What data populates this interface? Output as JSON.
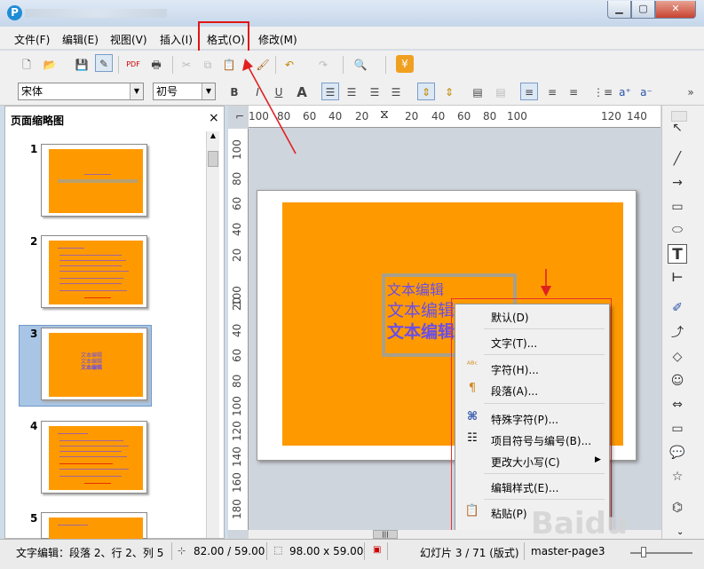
{
  "menubar": {
    "items": [
      "文件(F)",
      "编辑(E)",
      "视图(V)",
      "插入(I)",
      "格式(O)",
      "修改(M)"
    ]
  },
  "toolbar": {
    "font_name": "宋体",
    "font_size": "初号"
  },
  "panel": {
    "title": "页面缩略图",
    "close": "×",
    "slides": [
      {
        "num": "1"
      },
      {
        "num": "2"
      },
      {
        "num": "3",
        "lines": [
          "文本编辑",
          "文本编辑",
          "文本编辑"
        ]
      },
      {
        "num": "4"
      },
      {
        "num": "5"
      }
    ]
  },
  "ruler": {
    "h_ticks": [
      "100",
      "80",
      "60",
      "40",
      "20",
      "20",
      "40",
      "60",
      "80",
      "100",
      "120",
      "140"
    ],
    "v_ticks": [
      "100",
      "80",
      "60",
      "40",
      "20",
      "20",
      "40",
      "60",
      "80",
      "100",
      "120",
      "140",
      "160",
      "180"
    ]
  },
  "slide": {
    "text_lines": [
      "文本编辑",
      "文本编辑",
      "文本编辑"
    ]
  },
  "context_menu": {
    "items": [
      {
        "label": "默认(D)",
        "icon": ""
      },
      {
        "label": "文字(T)...",
        "icon": ""
      },
      {
        "label": "字符(H)...",
        "icon": "character-icon"
      },
      {
        "label": "段落(A)...",
        "icon": "paragraph-icon"
      },
      {
        "label": "特殊字符(P)...",
        "icon": "special-char-icon"
      },
      {
        "label": "项目符号与编号(B)...",
        "icon": "bullets-icon"
      },
      {
        "label": "更改大小写(C)",
        "icon": "submenu-arrow"
      },
      {
        "label": "编辑样式(E)...",
        "icon": ""
      },
      {
        "label": "粘贴(P)",
        "icon": "paste-icon"
      }
    ]
  },
  "status": {
    "mode": "文字编辑：段落 2、行 2、列 5",
    "position": "82.00 / 59.00",
    "size": "98.00 x 59.00",
    "slide_info": "幻灯片 3 / 71 (版式)",
    "master": "master-page3"
  },
  "watermark": "Baidu",
  "colors": {
    "slide_bg": "#fe9a00",
    "text": "#6b4ee6",
    "highlight": "#e01515"
  }
}
